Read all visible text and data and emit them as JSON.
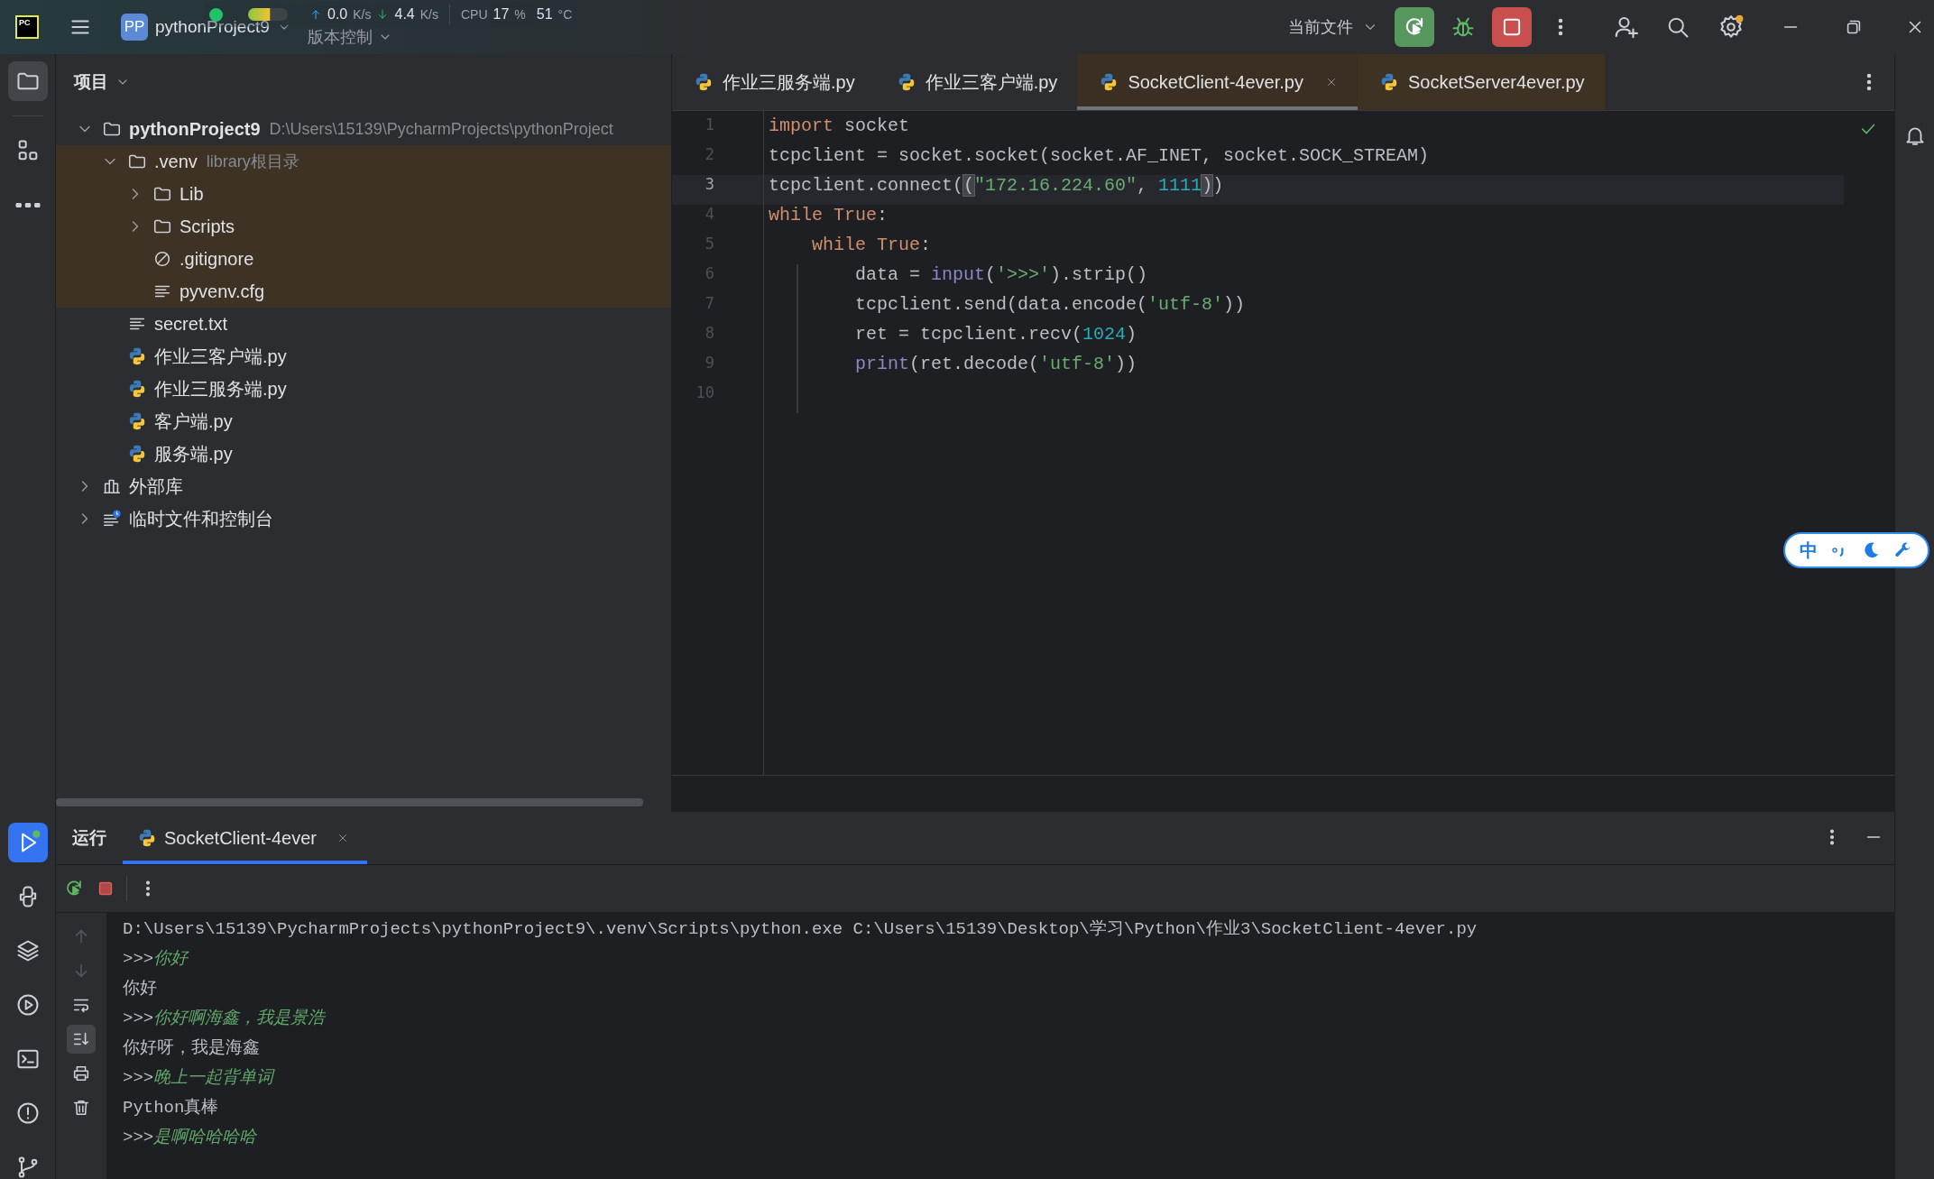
{
  "title_bar": {
    "logo_text": "PC",
    "project_badge": "PP",
    "project_name": "pythonProject9",
    "vcs_menu": "版本控制",
    "run_config": "当前文件"
  },
  "system_monitor": {
    "upload": "0.0",
    "upload_unit": "K/s",
    "download": "4.4",
    "download_unit": "K/s",
    "cpu_label": "CPU",
    "cpu": "17",
    "cpu_unit": "%",
    "temperature": "51",
    "temperature_unit": "°C"
  },
  "left_toolbar": {
    "top": [
      {
        "kind": "project",
        "selected": true
      },
      {
        "kind": "structure",
        "selected": false
      },
      {
        "kind": "more",
        "selected": false
      }
    ],
    "bottom": [
      {
        "kind": "run",
        "selected": true
      },
      {
        "kind": "python-console",
        "selected": false
      },
      {
        "kind": "python-packages",
        "selected": false
      },
      {
        "kind": "services",
        "selected": false
      },
      {
        "kind": "terminal",
        "selected": false
      },
      {
        "kind": "problems",
        "selected": false
      },
      {
        "kind": "git",
        "selected": false
      }
    ]
  },
  "project_panel": {
    "title": "项目",
    "tree": [
      {
        "label": "pythonProject9",
        "hint": "D:\\Users\\15139\\PycharmProjects\\pythonProject",
        "kind": "project",
        "expanded": true,
        "highlighted": false,
        "children": [
          {
            "label": ".venv",
            "hint": "library根目录",
            "kind": "folder",
            "expanded": true,
            "highlighted": true,
            "children": [
              {
                "label": "Lib",
                "kind": "folder",
                "expanded": false,
                "highlighted": true
              },
              {
                "label": "Scripts",
                "kind": "folder",
                "expanded": false,
                "highlighted": true
              },
              {
                "label": ".gitignore",
                "kind": "ignore-file",
                "highlighted": true
              },
              {
                "label": "pyvenv.cfg",
                "kind": "text-file",
                "highlighted": true
              }
            ]
          },
          {
            "label": "secret.txt",
            "kind": "text-file",
            "highlighted": false
          },
          {
            "label": "作业三客户端.py",
            "kind": "python-file",
            "highlighted": false
          },
          {
            "label": "作业三服务端.py",
            "kind": "python-file",
            "highlighted": false
          },
          {
            "label": "客户端.py",
            "kind": "python-file",
            "highlighted": false
          },
          {
            "label": "服务端.py",
            "kind": "python-file",
            "highlighted": false
          }
        ]
      },
      {
        "label": "外部库",
        "kind": "library",
        "expanded": false,
        "highlighted": false
      },
      {
        "label": "临时文件和控制台",
        "kind": "scratches",
        "expanded": false,
        "highlighted": false
      }
    ]
  },
  "editor": {
    "tabs": [
      {
        "label": "作业三服务端.py",
        "selected": false,
        "highlighted": false
      },
      {
        "label": "作业三客户端.py",
        "selected": false,
        "highlighted": false
      },
      {
        "label": "SocketClient-4ever.py",
        "selected": true,
        "highlighted": true
      },
      {
        "label": "SocketServer4ever.py",
        "selected": false,
        "highlighted": true
      }
    ],
    "lines": [
      {
        "number": "1",
        "current": false,
        "indent_guide": false,
        "tokens": [
          {
            "kind": "keyword",
            "text": "import"
          },
          {
            "kind": "plain",
            "text": " socket"
          }
        ]
      },
      {
        "number": "2",
        "current": false,
        "indent_guide": false,
        "tokens": [
          {
            "kind": "plain",
            "text": "tcpclient = socket.socket(socket.AF_INET, socket.SOCK_STREAM)"
          }
        ]
      },
      {
        "number": "3",
        "current": true,
        "indent_guide": false,
        "tokens": [
          {
            "kind": "plain",
            "text": "tcpclient.connect("
          },
          {
            "kind": "bracket-match",
            "text": "("
          },
          {
            "kind": "string",
            "text": "\"172.16.224.60\""
          },
          {
            "kind": "plain",
            "text": ", "
          },
          {
            "kind": "number",
            "text": "1111"
          },
          {
            "kind": "bracket-match",
            "text": ")"
          },
          {
            "kind": "plain",
            "text": ")"
          }
        ]
      },
      {
        "number": "4",
        "current": false,
        "indent_guide": false,
        "tokens": [
          {
            "kind": "keyword",
            "text": "while True"
          },
          {
            "kind": "plain",
            "text": ":"
          }
        ]
      },
      {
        "number": "5",
        "current": false,
        "indent_guide": false,
        "tokens": [
          {
            "kind": "keyword",
            "text": "    while True"
          },
          {
            "kind": "plain",
            "text": ":"
          }
        ]
      },
      {
        "number": "6",
        "current": false,
        "indent_guide": true,
        "tokens": [
          {
            "kind": "plain",
            "text": "        data = "
          },
          {
            "kind": "builtin",
            "text": "input"
          },
          {
            "kind": "plain",
            "text": "("
          },
          {
            "kind": "string",
            "text": "'>>>'"
          },
          {
            "kind": "plain",
            "text": ").strip()"
          }
        ]
      },
      {
        "number": "7",
        "current": false,
        "indent_guide": true,
        "tokens": [
          {
            "kind": "plain",
            "text": "        tcpclient.send(data.encode("
          },
          {
            "kind": "string",
            "text": "'utf-8'"
          },
          {
            "kind": "plain",
            "text": "))"
          }
        ]
      },
      {
        "number": "8",
        "current": false,
        "indent_guide": true,
        "tokens": [
          {
            "kind": "plain",
            "text": "        ret = tcpclient.recv("
          },
          {
            "kind": "number",
            "text": "1024"
          },
          {
            "kind": "plain",
            "text": ")"
          }
        ]
      },
      {
        "number": "9",
        "current": false,
        "indent_guide": true,
        "tokens": [
          {
            "kind": "builtin",
            "text": "        print"
          },
          {
            "kind": "plain",
            "text": "(ret.decode("
          },
          {
            "kind": "string",
            "text": "'utf-8'"
          },
          {
            "kind": "plain",
            "text": "))"
          }
        ]
      },
      {
        "number": "10",
        "current": false,
        "indent_guide": true
      }
    ]
  },
  "ime_widget": {
    "mode": "中"
  },
  "run_panel": {
    "title": "运行",
    "tabs": [
      {
        "label": "SocketClient-4ever",
        "selected": true
      }
    ],
    "console_tools": [
      {
        "kind": "scroll-up",
        "disabled": true,
        "on": false
      },
      {
        "kind": "scroll-down",
        "disabled": true,
        "on": false
      },
      {
        "kind": "soft-wrap",
        "disabled": false,
        "on": false
      },
      {
        "kind": "scroll-to-end",
        "disabled": false,
        "on": true
      },
      {
        "kind": "print",
        "disabled": false,
        "on": false
      },
      {
        "kind": "clear",
        "disabled": false,
        "on": false
      }
    ],
    "console": [
      {
        "kind": "command",
        "text": "D:\\Users\\15139\\PycharmProjects\\pythonProject9\\.venv\\Scripts\\python.exe C:\\Users\\15139\\Desktop\\学习\\Python\\作业3\\SocketClient-4ever.py"
      },
      {
        "kind": "input",
        "prompt": ">>>",
        "text": "你好"
      },
      {
        "kind": "output",
        "text": "你好"
      },
      {
        "kind": "input",
        "prompt": ">>>",
        "text": "你好啊海鑫，我是景浩"
      },
      {
        "kind": "output",
        "text": "你好呀，我是海鑫"
      },
      {
        "kind": "input",
        "prompt": ">>>",
        "text": "晚上一起背单词"
      },
      {
        "kind": "output",
        "text": "Python真棒"
      },
      {
        "kind": "input",
        "prompt": ">>>",
        "text": "是啊哈哈哈哈"
      }
    ]
  }
}
